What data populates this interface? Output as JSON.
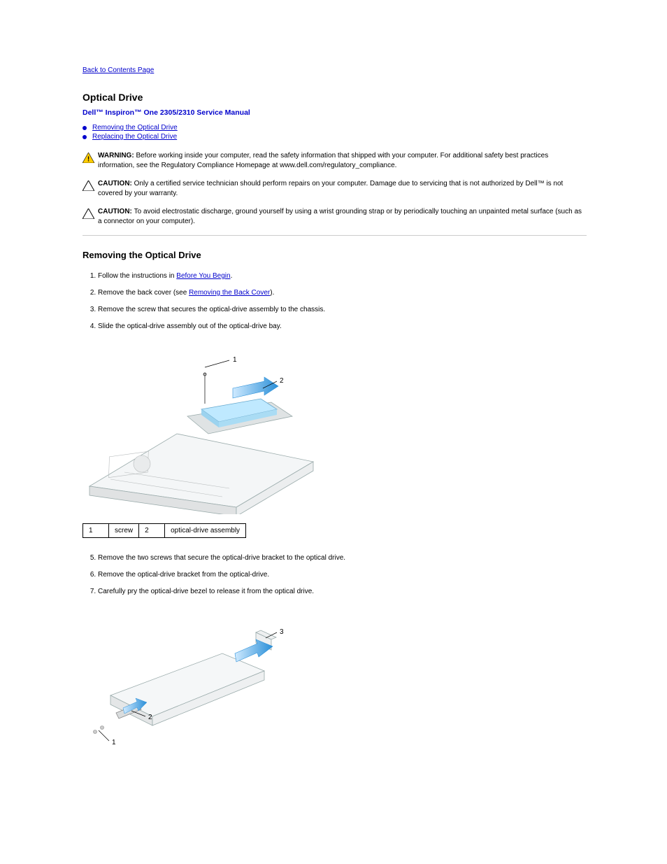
{
  "nav": {
    "back_link": "Back to Contents Page"
  },
  "header": {
    "page_title": "Optical Drive",
    "manual_title": "Dell™ Inspiron™ One 2305/2310 Service Manual"
  },
  "toc": {
    "items": [
      {
        "label": "Removing the Optical Drive"
      },
      {
        "label": "Replacing the Optical Drive"
      }
    ]
  },
  "notices": {
    "warning_prefix": "WARNING: ",
    "warning_text": "Before working inside your computer, read the safety information that shipped with your computer. For additional safety best practices information, see the Regulatory Compliance Homepage at www.dell.com/regulatory_compliance.",
    "caution1_prefix": "CAUTION: ",
    "caution1_text": "Only a certified service technician should perform repairs on your computer. Damage due to servicing that is not authorized by Dell™ is not covered by your warranty.",
    "caution2_prefix": "CAUTION: ",
    "caution2_text": "To avoid electrostatic discharge, ground yourself by using a wrist grounding strap or by periodically touching an unpainted metal surface (such as a connector on your computer)."
  },
  "section1": {
    "heading": "Removing the Optical Drive",
    "steps": {
      "s1a": "Follow the instructions in ",
      "s1_link": "Before You Begin",
      "s1b": ".",
      "s2a": "Remove the back cover (see ",
      "s2_link": "Removing the Back Cover",
      "s2b": ").",
      "s3": "Remove the screw that secures the optical-drive assembly to the chassis.",
      "s4": "Slide the optical-drive assembly out of the optical-drive bay."
    },
    "table": {
      "c1n": "1",
      "c1": "screw",
      "c2n": "2",
      "c2": "optical-drive assembly"
    },
    "steps2": {
      "s5": "Remove the two screws that secure the optical-drive bracket to the optical drive.",
      "s6": "Remove the optical-drive bracket from the optical-drive.",
      "s7": "Carefully pry the optical-drive bezel to release it from the optical drive."
    }
  }
}
